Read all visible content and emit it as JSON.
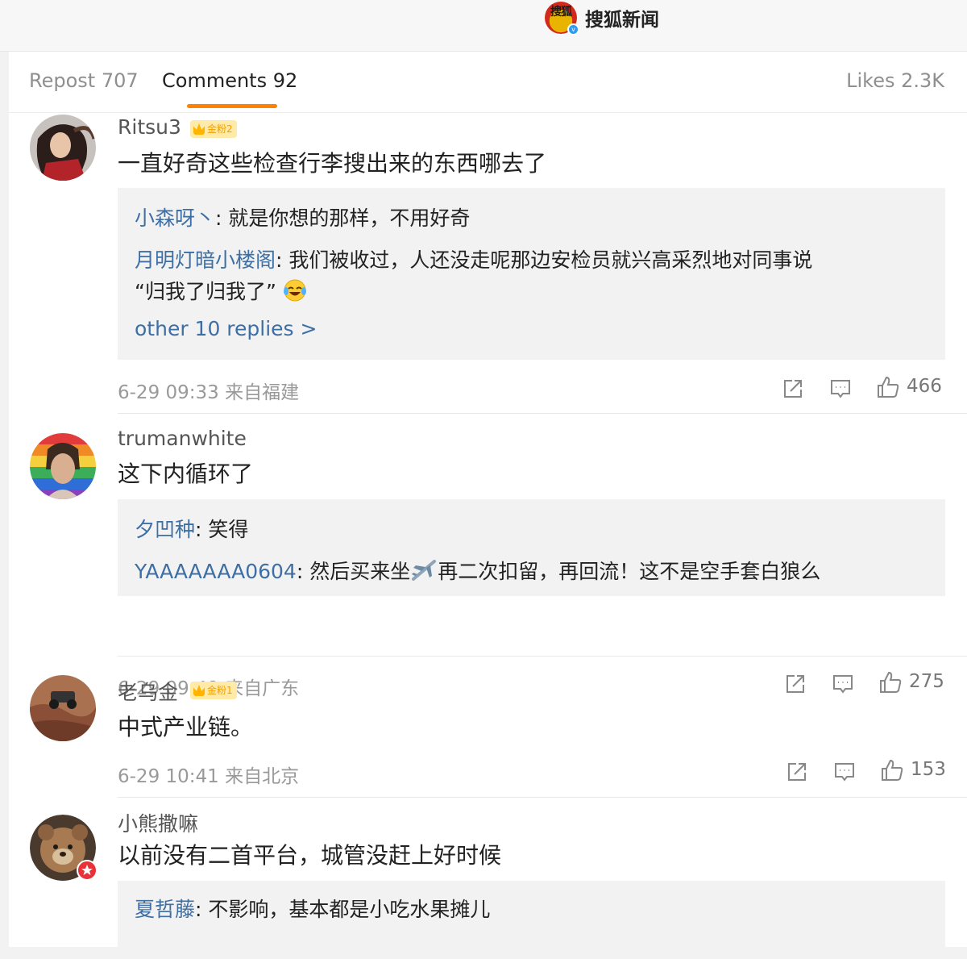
{
  "header": {
    "brand_logo_text": "搜狐",
    "brand_name": "搜狐新闻",
    "verified_mark": "v"
  },
  "tabs": {
    "repost": "Repost 707",
    "comments": "Comments 92",
    "likes": "Likes 2.3K"
  },
  "colors": {
    "accent": "#ff8200",
    "link": "#3d6fa5",
    "reply_bg": "#f2f2f2",
    "badge_bg": "#ffeaa8"
  },
  "comments": [
    {
      "username": "Ritsu3",
      "badge": "金粉2",
      "content": "一直好奇这些检查行李搜出来的东西哪去了",
      "replies": [
        {
          "name": "小森呀丶",
          "text": ": 就是你想的那样，不用好奇"
        },
        {
          "name": "月明灯暗小楼阁",
          "text": ": 我们被收过，人还没走呢那边安检员就兴高采烈地对同事说",
          "text2": "“归我了归我了”",
          "emoji": "laughing-crying-emoji"
        }
      ],
      "more_replies": "other 10 replies >",
      "meta": "6-29 09:33  来自福建",
      "likes": "466",
      "icons": [
        "share-icon",
        "comment-icon",
        "like-icon"
      ]
    },
    {
      "username": "trumanwhite",
      "content": "这下内循环了",
      "replies": [
        {
          "name": "夕凹种",
          "text": ": 笑得"
        },
        {
          "name": "YAAAAAAA0604",
          "text_before": ": 然后买来坐",
          "text": "再二次扣留，再回流！这不是空手套白狼么",
          "emoji": "airplane-emoji"
        }
      ],
      "meta": "6-29 09:49  来自广东",
      "likes": "275"
    },
    {
      "username": "老乌金",
      "badge": "金粉1",
      "content": "中式产业链。",
      "meta": "6-29 10:41  来自北京",
      "likes": "153"
    },
    {
      "username": "小熊撒嘛",
      "content": "以前没有二首平台，城管没赶上好时候",
      "replies": [
        {
          "name": "夏哲藤",
          "text": ": 不影响，基本都是小吃水果摊儿"
        }
      ]
    }
  ]
}
